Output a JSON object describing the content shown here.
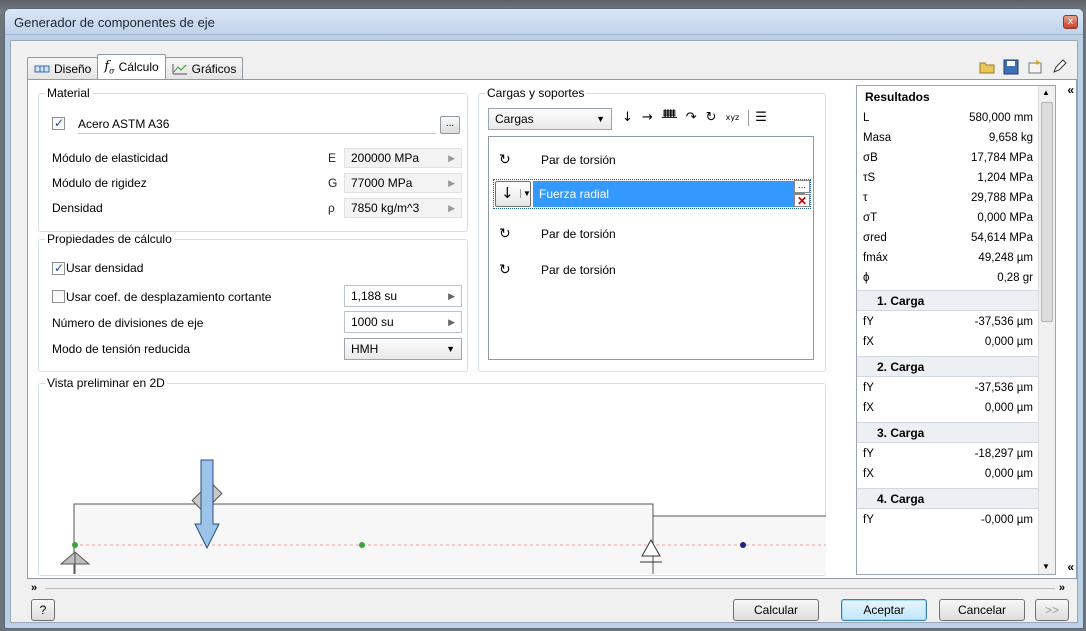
{
  "window": {
    "title": "Generador de componentes de eje",
    "close_label": "x"
  },
  "tabs": [
    {
      "label": "Diseño",
      "icon": "shaft-design-icon"
    },
    {
      "label": "Cálculo",
      "icon": "function-icon"
    },
    {
      "label": "Gráficos",
      "icon": "graph-icon"
    }
  ],
  "material": {
    "legend": "Material",
    "enabled": true,
    "name": "Acero ASTM A36",
    "browse_label": "...",
    "rows": [
      {
        "label": "Módulo de elasticidad",
        "symbol": "E",
        "value": "200000 MPa"
      },
      {
        "label": "Módulo de rigidez",
        "symbol": "G",
        "value": "77000 MPa"
      },
      {
        "label": "Densidad",
        "symbol": "ρ",
        "value": "7850 kg/m^3"
      }
    ]
  },
  "calc_props": {
    "legend": "Propiedades de cálculo",
    "use_density_label": "Usar densidad",
    "use_density": true,
    "shear_label": "Usar coef. de desplazamiento cortante",
    "shear_enabled": false,
    "shear_value": "1,188 su",
    "divisions_label": "Número de divisiones de eje",
    "divisions_value": "1000 su",
    "stress_mode_label": "Modo de tensión reducida",
    "stress_mode_value": "HMH"
  },
  "loads": {
    "legend": "Cargas y soportes",
    "filter_value": "Cargas",
    "toolbar_symbols": [
      "↓",
      "→",
      "ᚙ",
      "↷",
      "↻",
      "xyz",
      "☰"
    ],
    "items": [
      {
        "label": "Par de torsión",
        "icon": "torque-icon",
        "selected": false
      },
      {
        "label": "Fuerza radial",
        "icon": "radial-force-icon",
        "selected": true
      },
      {
        "label": "Par de torsión",
        "icon": "torque-icon",
        "selected": false
      },
      {
        "label": "Par de torsión",
        "icon": "torque-icon",
        "selected": false
      }
    ]
  },
  "preview": {
    "legend": "Vista preliminar en 2D"
  },
  "results": {
    "header": "Resultados",
    "rows": [
      {
        "key": "L",
        "value": "580,000 mm"
      },
      {
        "key": "Masa",
        "value": "9,658 kg"
      },
      {
        "key": "σB",
        "value": "17,784 MPa"
      },
      {
        "key": "τS",
        "value": "1,204 MPa"
      },
      {
        "key": "τ",
        "value": "29,788 MPa"
      },
      {
        "key": "σT",
        "value": "0,000 MPa"
      },
      {
        "key": "σred",
        "value": "54,614 MPa"
      },
      {
        "key": "fmáx",
        "value": "49,248 µm"
      },
      {
        "key": "ϕ",
        "value": "0,28 gr"
      }
    ],
    "groups": [
      {
        "title": "1. Carga",
        "rows": [
          {
            "key": "fY",
            "value": "-37,536 µm"
          },
          {
            "key": "fX",
            "value": "0,000 µm"
          }
        ]
      },
      {
        "title": "2. Carga",
        "rows": [
          {
            "key": "fY",
            "value": "-37,536 µm"
          },
          {
            "key": "fX",
            "value": "0,000 µm"
          }
        ]
      },
      {
        "title": "3. Carga",
        "rows": [
          {
            "key": "fY",
            "value": "-18,297 µm"
          },
          {
            "key": "fX",
            "value": "0,000 µm"
          }
        ]
      },
      {
        "title": "4. Carga",
        "rows": [
          {
            "key": "fY",
            "value": "-0,000 µm"
          }
        ]
      }
    ]
  },
  "footer": {
    "help_label": "?",
    "calc_label": "Calcular",
    "ok_label": "Aceptar",
    "cancel_label": "Cancelar",
    "more_label": ">>"
  },
  "colors": {
    "accent": "#3399ff",
    "arrow_fill": "#9cc3ea",
    "node_green": "#3aa53a",
    "node_blue": "#1a237e"
  }
}
